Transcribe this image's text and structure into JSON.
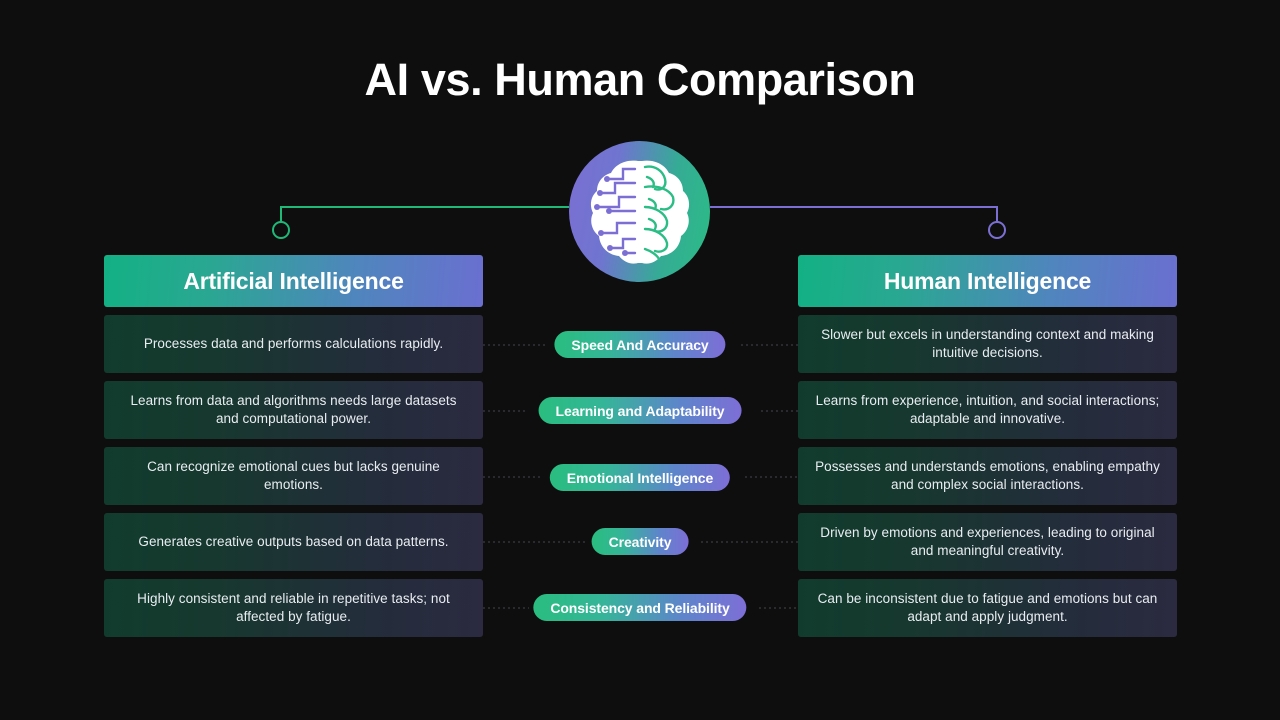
{
  "slide": {
    "title": "AI vs. Human Comparison",
    "background_color": "#0e0e0f"
  },
  "emblem": {
    "name": "ai-human-brain-icon",
    "left_half": "circuit-board-brain",
    "right_half": "organic-brain",
    "gradient_from": "#7b6fd4",
    "gradient_to": "#2bbd85"
  },
  "connectors": {
    "left_line_color": "#1fb877",
    "right_line_color": "#7b6fd4",
    "row_link_color": "#4a4a52"
  },
  "columns": {
    "left": {
      "header": "Artificial Intelligence",
      "rows": [
        "Processes data and performs calculations rapidly.",
        "Learns from data and algorithms needs large datasets and computational power.",
        "Can recognize emotional cues but lacks genuine emotions.",
        "Generates creative outputs based on data patterns.",
        "Highly consistent and reliable in repetitive tasks; not affected by fatigue."
      ]
    },
    "right": {
      "header": "Human Intelligence",
      "rows": [
        "Slower but excels in understanding context and making intuitive decisions.",
        "Learns from experience, intuition, and social interactions; adaptable and innovative.",
        "Possesses and understands emotions, enabling empathy and complex social interactions.",
        "Driven by emotions and experiences, leading to original and meaningful creativity.",
        "Can be inconsistent due to fatigue and emotions but can adapt and apply judgment."
      ]
    }
  },
  "criteria": [
    "Speed And Accuracy",
    "Learning and Adaptability",
    "Emotional Intelligence",
    "Creativity",
    "Consistency and Reliability"
  ],
  "theme": {
    "header_gradient_from": "#13b184",
    "header_gradient_to": "#6a6fd0",
    "card_gradient_from": "#113c2d",
    "card_gradient_to": "#2b2a40",
    "pill_gradient_from": "#29bd7f",
    "pill_gradient_to": "#7d6ed6"
  }
}
